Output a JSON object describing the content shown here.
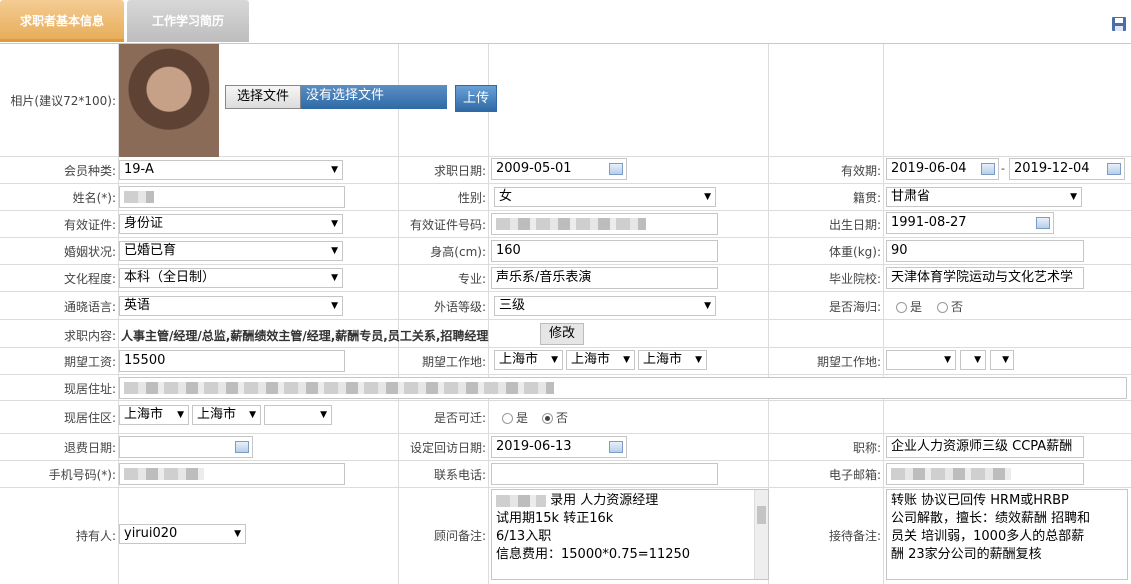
{
  "tabs": [
    {
      "label": "求职者基本信息"
    },
    {
      "label": "工作学习简历"
    }
  ],
  "photo": {
    "label": "相片(建议72*100):",
    "file_button": "选择文件",
    "file_status": "没有选择文件",
    "upload_button": "上传"
  },
  "member_type": {
    "label": "会员种类:",
    "value": "19-A"
  },
  "job_date": {
    "label": "求职日期:",
    "value": "2009-05-01"
  },
  "valid_period": {
    "label": "有效期:",
    "from": "2019-06-04",
    "sep": "-",
    "to": "2019-12-04"
  },
  "name": {
    "label": "姓名(*):"
  },
  "gender": {
    "label": "性别:",
    "value": "女"
  },
  "hometown": {
    "label": "籍贯:",
    "value": "甘肃省"
  },
  "id_type": {
    "label": "有效证件:",
    "value": "身份证"
  },
  "id_number": {
    "label": "有效证件号码:"
  },
  "birth": {
    "label": "出生日期:",
    "value": "1991-08-27"
  },
  "marital": {
    "label": "婚姻状况:",
    "value": "已婚已育"
  },
  "height": {
    "label": "身高(cm):",
    "value": "160"
  },
  "weight": {
    "label": "体重(kg):",
    "value": "90"
  },
  "education": {
    "label": "文化程度:",
    "value": "本科（全日制）"
  },
  "major": {
    "label": "专业:",
    "value": "声乐系/音乐表演"
  },
  "school": {
    "label": "毕业院校:",
    "value": "天津体育学院运动与文化艺术学"
  },
  "language": {
    "label": "通晓语言:",
    "value": "英语"
  },
  "lang_level": {
    "label": "外语等级:",
    "value": "三级"
  },
  "overseas": {
    "label": "是否海归:",
    "yes": "是",
    "no": "否"
  },
  "job_content": {
    "label": "求职内容:",
    "value": "人事主管/经理/总监,薪酬绩效主管/经理,薪酬专员,员工关系,招聘经理",
    "modify_button": "修改"
  },
  "salary": {
    "label": "期望工资:",
    "value": "15500"
  },
  "work_place": {
    "label": "期望工作地:",
    "v1": "上海市",
    "v2": "上海市",
    "v3": "上海市"
  },
  "work_place2": {
    "label": "期望工作地:"
  },
  "address": {
    "label": "现居住址:"
  },
  "district": {
    "label": "现居住区:",
    "v1": "上海市",
    "v2": "上海市"
  },
  "relocate": {
    "label": "是否可迁:",
    "yes": "是",
    "no": "否"
  },
  "refund_date": {
    "label": "退费日期:"
  },
  "revisit_date": {
    "label": "设定回访日期:",
    "value": "2019-06-13"
  },
  "title": {
    "label": "职称:",
    "value": "企业人力资源师三级 CCPA薪酬"
  },
  "mobile": {
    "label": "手机号码(*):"
  },
  "phone": {
    "label": "联系电话:"
  },
  "email": {
    "label": "电子邮箱:"
  },
  "holder": {
    "label": "持有人:",
    "value": "yirui020"
  },
  "consultant_note": {
    "label": "顾问备注:",
    "lines": [
      "录用  人力资源经理",
      "试用期15k 转正16k",
      "6/13入职",
      "信息费用：15000*0.75=11250"
    ]
  },
  "reception_note": {
    "label": "接待备注:",
    "lines": [
      "转账 协议已回传 HRM或HRBP",
      "公司解散，擅长：绩效薪酬 招聘和",
      "员关  培训弱，1000多人的总部薪",
      "酬 23家分公司的薪酬复核"
    ]
  }
}
